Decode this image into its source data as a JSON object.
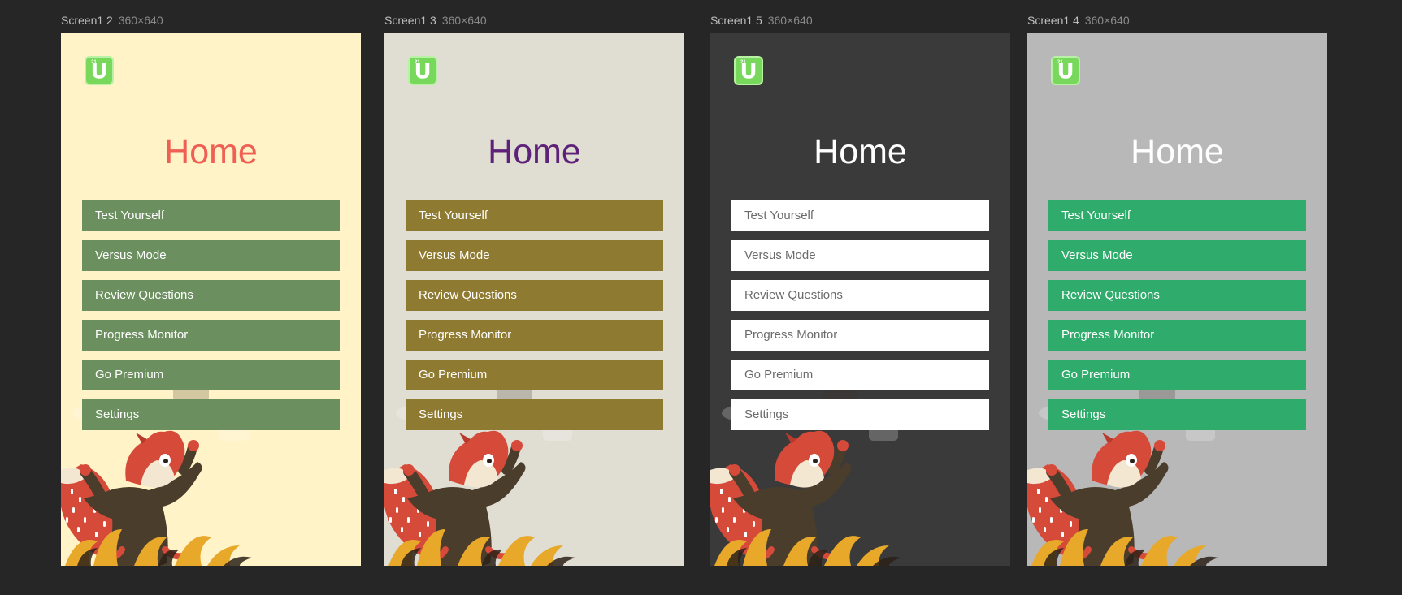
{
  "artboards": [
    {
      "name": "Screen1 2",
      "size": "360×640",
      "title": "Home",
      "colors": {
        "background": "#fff3c7",
        "title": "#f05f54",
        "button_bg": "#6b8f5f",
        "button_text": "#ffffff"
      }
    },
    {
      "name": "Screen1 3",
      "size": "360×640",
      "title": "Home",
      "colors": {
        "background": "#e0ddd2",
        "title": "#5e217a",
        "button_bg": "#8f7a31",
        "button_text": "#ffffff"
      }
    },
    {
      "name": "Screen1 5",
      "size": "360×640",
      "title": "Home",
      "colors": {
        "background": "#3a3a3a",
        "title": "#ffffff",
        "button_bg": "#ffffff",
        "button_text": "#6b6b6b"
      }
    },
    {
      "name": "Screen1 4",
      "size": "360×640",
      "title": "Home",
      "colors": {
        "background": "#b8b8b8",
        "title": "#ffffff",
        "button_bg": "#2fab6b",
        "button_text": "#ffffff"
      }
    }
  ],
  "logo": {
    "icon": "u-app-logo-icon",
    "glyph": "U",
    "superscript": "21"
  },
  "menu": [
    "Test Yourself",
    "Versus Mode",
    "Review Questions",
    "Progress Monitor",
    "Go Premium",
    "Settings"
  ],
  "illustration": {
    "icon": "fox-mascot-icon"
  }
}
